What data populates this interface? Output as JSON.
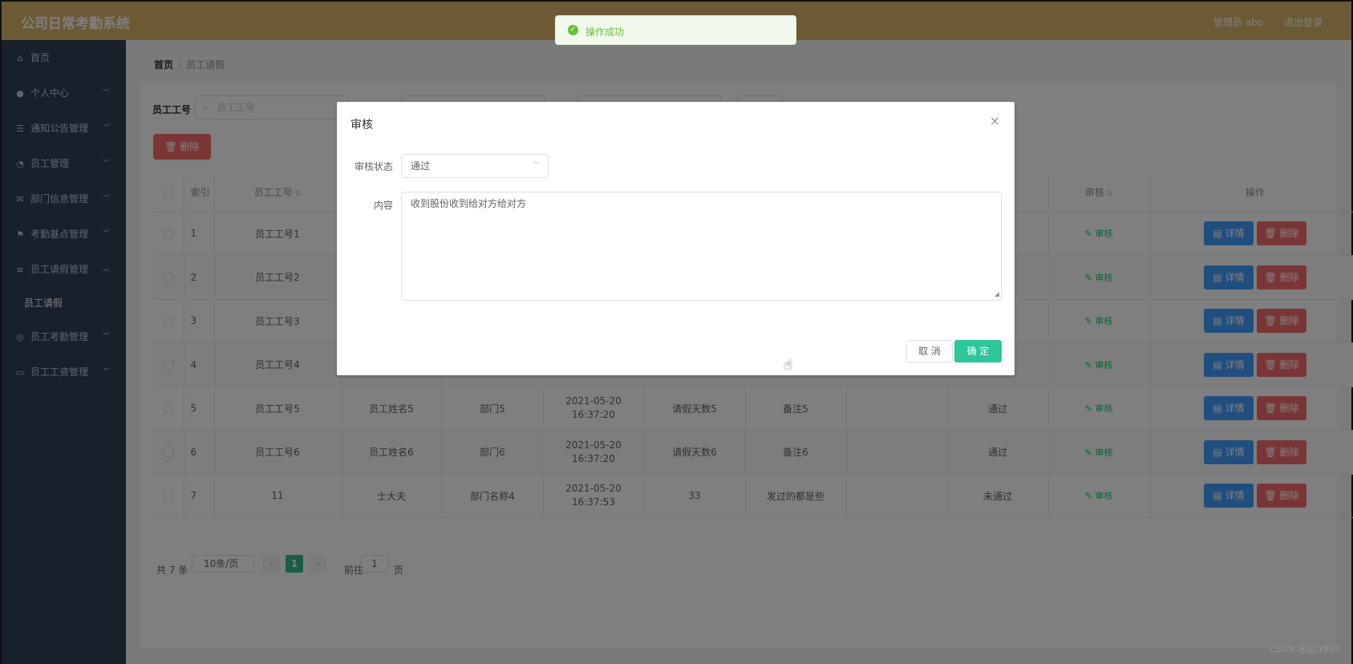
{
  "header": {
    "app_title": "公司日常考勤系统",
    "user_label": "管理员 abo",
    "logout_label": "退出登录"
  },
  "sidebar": {
    "items": [
      {
        "label": "首页",
        "icon": "home-icon",
        "glyph": "⌂"
      },
      {
        "label": "个人中心",
        "icon": "user-icon",
        "glyph": "●"
      },
      {
        "label": "通知公告管理",
        "icon": "list-icon",
        "glyph": "☰"
      },
      {
        "label": "员工管理",
        "icon": "clock-icon",
        "glyph": "◔"
      },
      {
        "label": "部门信息管理",
        "icon": "mail-icon",
        "glyph": "✉"
      },
      {
        "label": "考勤基点管理",
        "icon": "flag-icon",
        "glyph": "⚑"
      },
      {
        "label": "员工请假管理",
        "icon": "sliders-icon",
        "glyph": "≡"
      },
      {
        "label": "员工考勤管理",
        "icon": "globe-icon",
        "glyph": "◎"
      },
      {
        "label": "员工工资管理",
        "icon": "card-icon",
        "glyph": "▭"
      }
    ],
    "submenu_label": "员工请假"
  },
  "breadcrumb": {
    "home": "首页",
    "current": "员工请假"
  },
  "search": {
    "label": "员工工号",
    "placeholder": "员工工号"
  },
  "toolbar": {
    "delete_label": "删除"
  },
  "table": {
    "headers": {
      "index": "索引",
      "emp_no": "员工工号",
      "audit": "审核",
      "actions": "操作"
    },
    "audit_link": "审核",
    "detail_label": "详情",
    "delete_label": "删除",
    "rows": [
      {
        "idx": "1",
        "emp_no": "员工工号1",
        "name": "",
        "dept": "",
        "time": "",
        "days": "",
        "remark": "",
        "reply": "",
        "status": ""
      },
      {
        "idx": "2",
        "emp_no": "员工工号2",
        "name": "",
        "dept": "",
        "time": "",
        "days": "",
        "remark": "",
        "reply": "",
        "status": ""
      },
      {
        "idx": "3",
        "emp_no": "员工工号3",
        "name": "",
        "dept": "",
        "time": "",
        "days": "",
        "remark": "",
        "reply": "",
        "status": ""
      },
      {
        "idx": "4",
        "emp_no": "员工工号4",
        "name": "",
        "dept": "",
        "time": "",
        "days": "",
        "remark": "",
        "reply": "",
        "status": ""
      },
      {
        "idx": "5",
        "emp_no": "员工工号5",
        "name": "员工姓名5",
        "dept": "部门5",
        "time": "2021-05-20 16:37:20",
        "days": "请假天数5",
        "remark": "备注5",
        "reply": "",
        "status": "通过"
      },
      {
        "idx": "6",
        "emp_no": "员工工号6",
        "name": "员工姓名6",
        "dept": "部门6",
        "time": "2021-05-20 16:37:20",
        "days": "请假天数6",
        "remark": "备注6",
        "reply": "",
        "status": "通过"
      },
      {
        "idx": "7",
        "emp_no": "11",
        "name": "士大夫",
        "dept": "部门名称4",
        "time": "2021-05-20 16:37:53",
        "days": "33",
        "remark": "发过的都是些",
        "reply": "",
        "status": "未通过"
      }
    ]
  },
  "pagination": {
    "total_label": "共 7 条",
    "page_size": "10条/页",
    "current_page": "1",
    "jump_prefix": "前往",
    "jump_value": "1",
    "jump_suffix": "页"
  },
  "toast": {
    "message": "操作成功"
  },
  "dialog": {
    "title": "审核",
    "status_label": "审核状态",
    "status_value": "通过",
    "content_label": "内容",
    "content_value": "收到股份收到给对方给对方",
    "cancel_label": "取 消",
    "confirm_label": "确 定"
  },
  "watermark": "CSDN @gp1803",
  "colors": {
    "header": "#d9b56a",
    "sidebar": "#304156",
    "primary": "#409eff",
    "danger": "#f56c6c",
    "success": "#67c23a",
    "confirm": "#2dc79a"
  }
}
